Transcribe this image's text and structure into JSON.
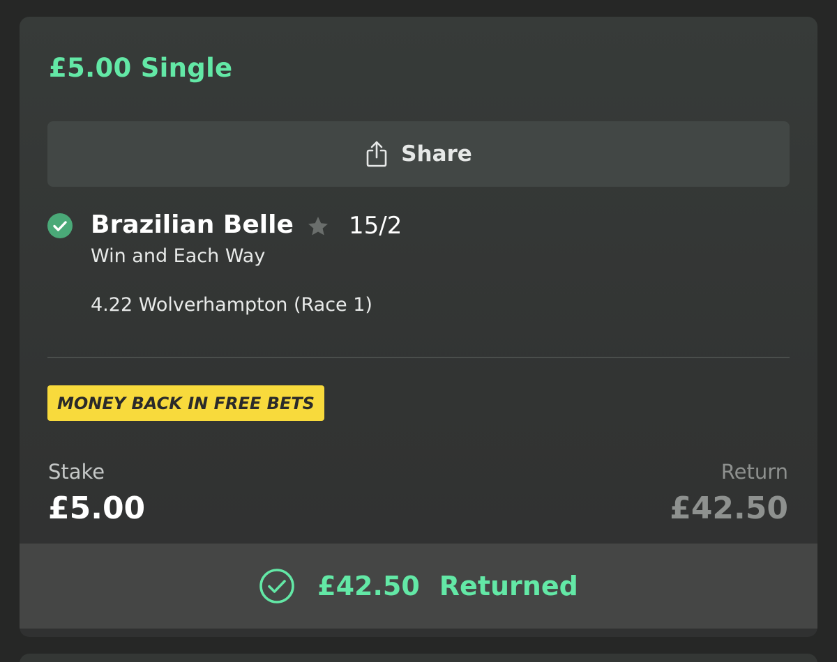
{
  "bet": {
    "title": "£5.00 Single",
    "share_label": "Share",
    "selection": {
      "name": "Brazilian Belle",
      "odds": "15/2",
      "market": "Win and Each Way",
      "event": "4.22 Wolverhampton (Race 1)",
      "status_icon": "check-circle-icon",
      "favourite_icon": "star-icon"
    },
    "promo_badge": "MONEY BACK IN FREE BETS",
    "stake": {
      "label": "Stake",
      "value": "£5.00"
    },
    "return": {
      "label": "Return",
      "value": "£42.50"
    },
    "settlement": {
      "amount": "£42.50",
      "status": "Returned"
    }
  },
  "colors": {
    "accent_green": "#63e8a6",
    "badge_yellow": "#f8da3c",
    "card_bg": "#353837",
    "footer_bg": "#454645",
    "muted_text": "#8e918f"
  }
}
